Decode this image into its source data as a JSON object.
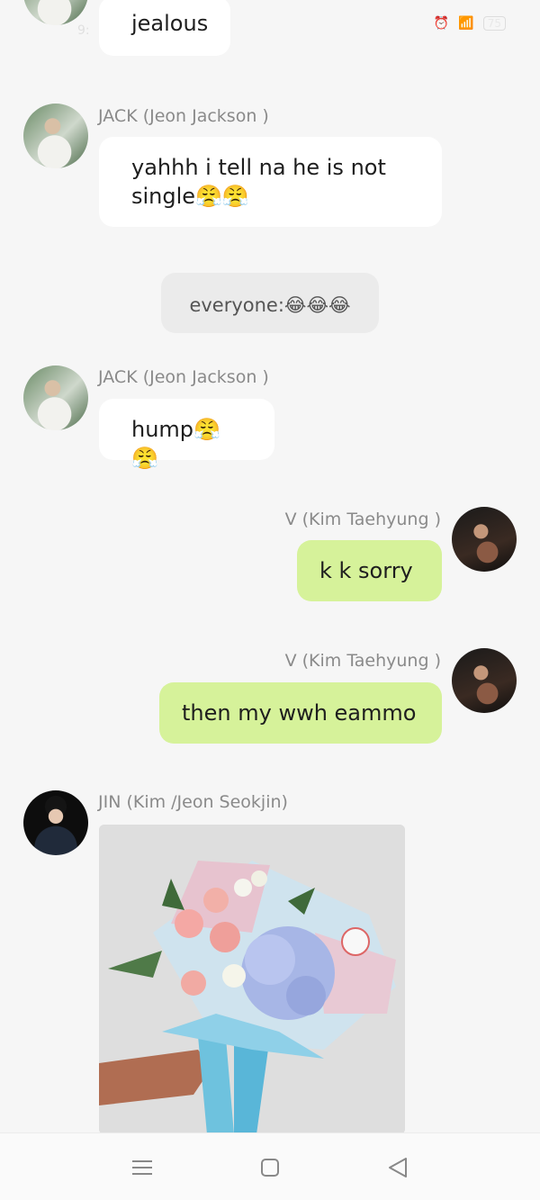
{
  "status_bar": {
    "time": "9:",
    "battery": "75"
  },
  "messages": [
    {
      "sender": "",
      "text": "jealous"
    },
    {
      "sender": "JACK (Jeon Jackson )",
      "text": "yahhh i tell na he is not single😤😤"
    },
    {
      "sender": "",
      "text": "everyone:😂😂😂"
    },
    {
      "sender": "JACK (Jeon Jackson )",
      "text": "hump😤😤"
    },
    {
      "sender": "V (Kim Taehyung )",
      "text": "k k sorry"
    },
    {
      "sender": "V (Kim Taehyung )",
      "text": "then my wwh eammo"
    },
    {
      "sender": "JIN (Kim /Jeon Seokjin)",
      "text": ""
    }
  ],
  "colors": {
    "background": "#f6f6f6",
    "incoming_bubble": "#ffffff",
    "outgoing_bubble": "#d6f29a",
    "system_bubble": "#ebebeb",
    "name_text": "#8a8a8a"
  },
  "icons": {
    "nav_menu": "menu-icon",
    "nav_home": "home-icon",
    "nav_back": "back-icon"
  }
}
